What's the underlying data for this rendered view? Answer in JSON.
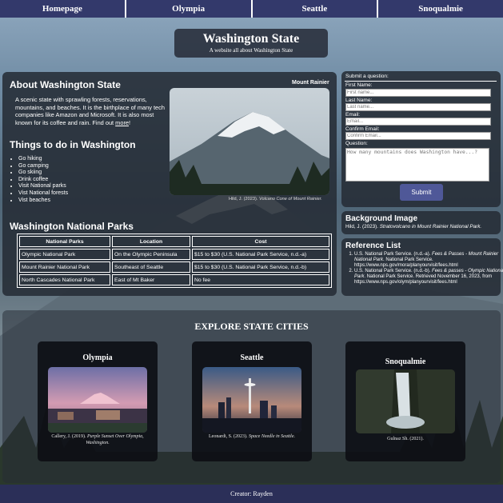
{
  "nav": {
    "items": [
      "Homepage",
      "Olympia",
      "Seattle",
      "Snoqualmie"
    ]
  },
  "hero": {
    "title": "Washington State",
    "subtitle": "A website all about Washington State"
  },
  "about": {
    "heading": "About Washington State",
    "text": "A scenic state with sprawling forests, reservations, mountains, and beaches. It is the birthplace of many tech companies like Amazon and Microsoft. It is also most known for its coffee and rain. Find out ",
    "more_link": "more",
    "text_end": "!",
    "photo_label": "Mount Rainier",
    "photo_caption_author": "Hild, J. (2023). ",
    "photo_caption_title": "Volcano Cone of Mount Rainier."
  },
  "things": {
    "heading": "Things to do in Washington",
    "items": [
      "Go hiking",
      "Go camping",
      "Go skiing",
      "Drink coffee",
      "Visit National parks",
      "Vist National forests",
      "Vist beaches"
    ]
  },
  "parks": {
    "heading": "Washington National Parks",
    "columns": [
      "National Parks",
      "Location",
      "Cost"
    ],
    "rows": [
      [
        "Olympic National Park",
        "On the Olympic Peninsula",
        "$15 to $30 (U.S. National Park Service, n.d.-a)"
      ],
      [
        "Mount Rainier National Park",
        "Southeast of Seattle",
        "$15 to $30 (U.S. National Park Service, n.d.-b)"
      ],
      [
        "North Cascades National Park",
        "East of Mt Baker",
        "No fee"
      ]
    ]
  },
  "form": {
    "title": "Submit a question:",
    "first_label": "First Name:",
    "first_placeholder": "First name...",
    "last_label": "Last Name:",
    "last_placeholder": "Last name...",
    "email_label": "Email:",
    "email_placeholder": "Email...",
    "confirm_label": "Confirm Email:",
    "confirm_placeholder": "Confirm Email...",
    "question_label": "Question:",
    "question_placeholder": "How many mountains does Washington have...?",
    "submit_label": "Submit"
  },
  "background_image": {
    "heading": "Background Image",
    "credit_author": "Hild, J. (2023). ",
    "credit_title": "Stratovolcano in Mount Rainier National Park."
  },
  "references": {
    "heading": "Reference List",
    "items": [
      {
        "a": "U.S. National Park Service. (n.d.-a). ",
        "i": "Fees & Passes - Mount Rainier National Park",
        "b": ". National Park Service. https://www.nps.gov/mora/planyourvisit/fees.html"
      },
      {
        "a": "U.S. National Park Service. (n.d.-b). ",
        "i": "Fees & passes - Olympic National Park",
        "b": ". National Park Service. Retrieved November 16, 2023, from https://www.nps.gov/olym/planyourvisit/fees.html"
      }
    ]
  },
  "explore": {
    "heading": "EXPLORE STATE CITIES",
    "cards": [
      {
        "title": "Olympia",
        "caption_a": "Callery, J. (2019). ",
        "caption_i": "Purple Sunset Over Olympia, Washington."
      },
      {
        "title": "Seattle",
        "caption_a": "Leonardi, S. (2023). ",
        "caption_i": "Space Needle in Seattle."
      },
      {
        "title": "Snoqualmie",
        "caption_a": "Gulnaz Sh. (2021).",
        "caption_i": ""
      }
    ]
  },
  "footer": {
    "text": "Creator: Rayden"
  },
  "colors": {
    "nav": "#33396b",
    "footer": "#2b2f58",
    "submit": "#4f5898",
    "panel": "#262c36"
  }
}
